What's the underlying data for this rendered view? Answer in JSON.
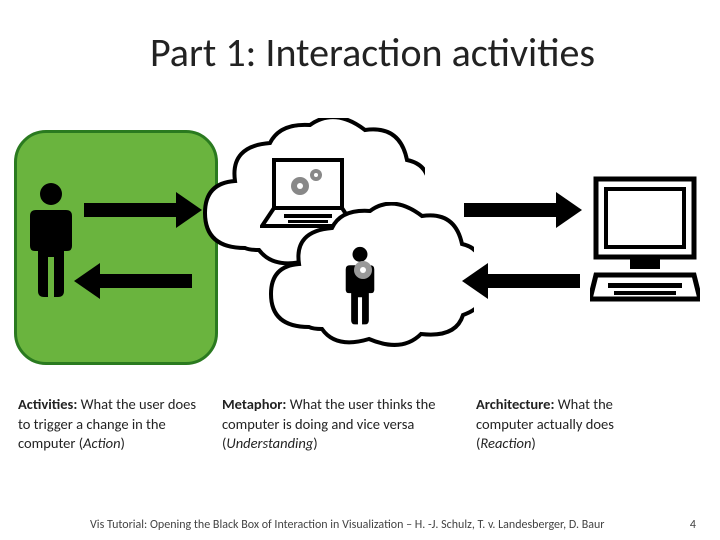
{
  "title": "Part 1: Interaction activities",
  "captions": {
    "c1_bold": "Activities:",
    "c1_rest": " What the user does to trigger a change in the computer (",
    "c1_ital": "Action",
    "c1_end": ")",
    "c2_bold": "Metaphor:",
    "c2_rest": " What the user thinks the computer is doing and vice versa (",
    "c2_ital": "Understanding",
    "c2_end": ")",
    "c3_bold": "Architecture:",
    "c3_rest": " What the computer actually does (",
    "c3_ital": "Reaction",
    "c3_end": ")"
  },
  "footer": {
    "text": "Vis Tutorial: Opening the Black Box of Interaction in Visualization – H. -J. Schulz, T. v. Landesberger, D. Baur",
    "page": "4"
  }
}
